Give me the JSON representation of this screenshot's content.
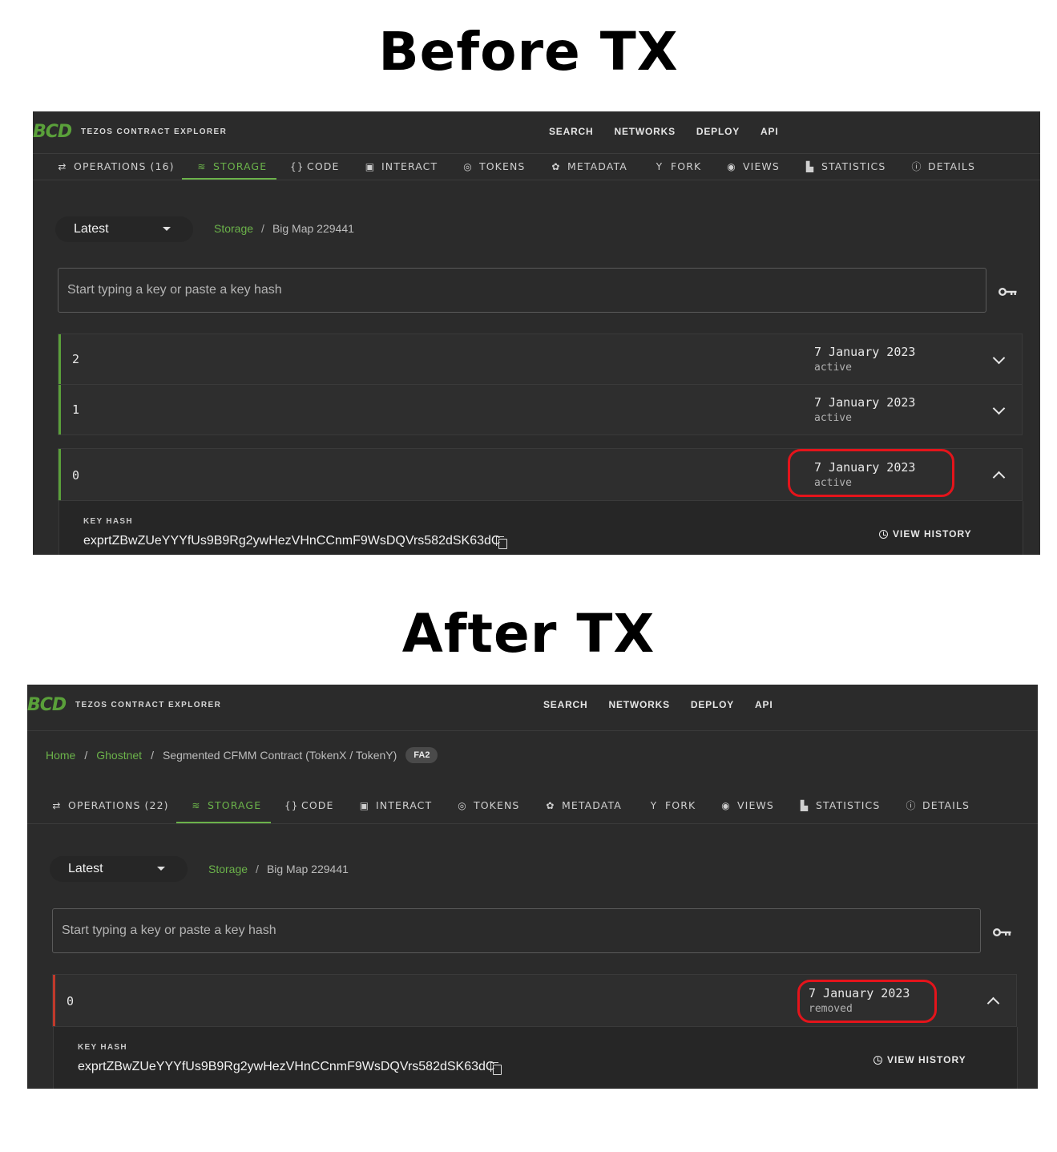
{
  "before": {
    "heading": "Before TX",
    "logo": "BCD",
    "brand": "TEZOS CONTRACT EXPLORER",
    "topnav": [
      "SEARCH",
      "NETWORKS",
      "DEPLOY",
      "API"
    ],
    "tabs": [
      {
        "label": "OPERATIONS (16)",
        "icon": "⇄",
        "icon_name": "swap-icon"
      },
      {
        "label": "STORAGE",
        "icon": "≋",
        "icon_name": "database-icon",
        "active": true
      },
      {
        "label": "CODE",
        "icon": "{}",
        "icon_name": "code-braces-icon"
      },
      {
        "label": "INTERACT",
        "icon": "▣",
        "icon_name": "play-box-icon"
      },
      {
        "label": "TOKENS",
        "icon": "◎",
        "icon_name": "tokens-icon"
      },
      {
        "label": "METADATA",
        "icon": "✿",
        "icon_name": "puzzle-icon"
      },
      {
        "label": "FORK",
        "icon": "Y",
        "icon_name": "fork-icon"
      },
      {
        "label": "VIEWS",
        "icon": "◉",
        "icon_name": "eye-icon"
      },
      {
        "label": "STATISTICS",
        "icon": "▙",
        "icon_name": "chart-icon"
      },
      {
        "label": "DETAILS",
        "icon": "ⓘ",
        "icon_name": "info-icon"
      }
    ],
    "select_value": "Latest",
    "crumbs": {
      "storage": "Storage",
      "sep": "/",
      "bigmap": "Big Map 229441"
    },
    "search_placeholder": "Start typing a key or paste a key hash",
    "rows": [
      {
        "key": "2",
        "date": "7 January 2023",
        "status": "active"
      },
      {
        "key": "1",
        "date": "7 January 2023",
        "status": "active"
      },
      {
        "key": "0",
        "date": "7 January 2023",
        "status": "active"
      }
    ],
    "key_hash_label": "KEY HASH",
    "key_hash": "exprtZBwZUeYYYfUs9B9Rg2ywHezVHnCCnmF9WsDQVrs582dSK63dC",
    "view_history": "VIEW HISTORY",
    "colors": {
      "accent": "#6bb24a",
      "highlight": "#e4141b"
    }
  },
  "after": {
    "heading": "After TX",
    "logo": "BCD",
    "brand": "TEZOS CONTRACT EXPLORER",
    "topnav": [
      "SEARCH",
      "NETWORKS",
      "DEPLOY",
      "API"
    ],
    "page_crumbs": {
      "home": "Home",
      "network": "Ghostnet",
      "contract": "Segmented CFMM Contract (TokenX / TokenY)",
      "badge": "FA2",
      "sep": "/"
    },
    "tabs": [
      {
        "label": "OPERATIONS (22)",
        "icon": "⇄",
        "icon_name": "swap-icon"
      },
      {
        "label": "STORAGE",
        "icon": "≋",
        "icon_name": "database-icon",
        "active": true
      },
      {
        "label": "CODE",
        "icon": "{}",
        "icon_name": "code-braces-icon"
      },
      {
        "label": "INTERACT",
        "icon": "▣",
        "icon_name": "play-box-icon"
      },
      {
        "label": "TOKENS",
        "icon": "◎",
        "icon_name": "tokens-icon"
      },
      {
        "label": "METADATA",
        "icon": "✿",
        "icon_name": "puzzle-icon"
      },
      {
        "label": "FORK",
        "icon": "Y",
        "icon_name": "fork-icon"
      },
      {
        "label": "VIEWS",
        "icon": "◉",
        "icon_name": "eye-icon"
      },
      {
        "label": "STATISTICS",
        "icon": "▙",
        "icon_name": "chart-icon"
      },
      {
        "label": "DETAILS",
        "icon": "ⓘ",
        "icon_name": "info-icon"
      }
    ],
    "select_value": "Latest",
    "crumbs": {
      "storage": "Storage",
      "sep": "/",
      "bigmap": "Big Map 229441"
    },
    "search_placeholder": "Start typing a key or paste a key hash",
    "rows": [
      {
        "key": "0",
        "date": "7 January 2023",
        "status": "removed"
      }
    ],
    "key_hash_label": "KEY HASH",
    "key_hash": "exprtZBwZUeYYYfUs9B9Rg2ywHezVHnCCnmF9WsDQVrs582dSK63dC",
    "view_history": "VIEW HISTORY",
    "colors": {
      "accent": "#6bb24a",
      "removed_bar": "#c0392b",
      "highlight": "#e4141b"
    }
  }
}
